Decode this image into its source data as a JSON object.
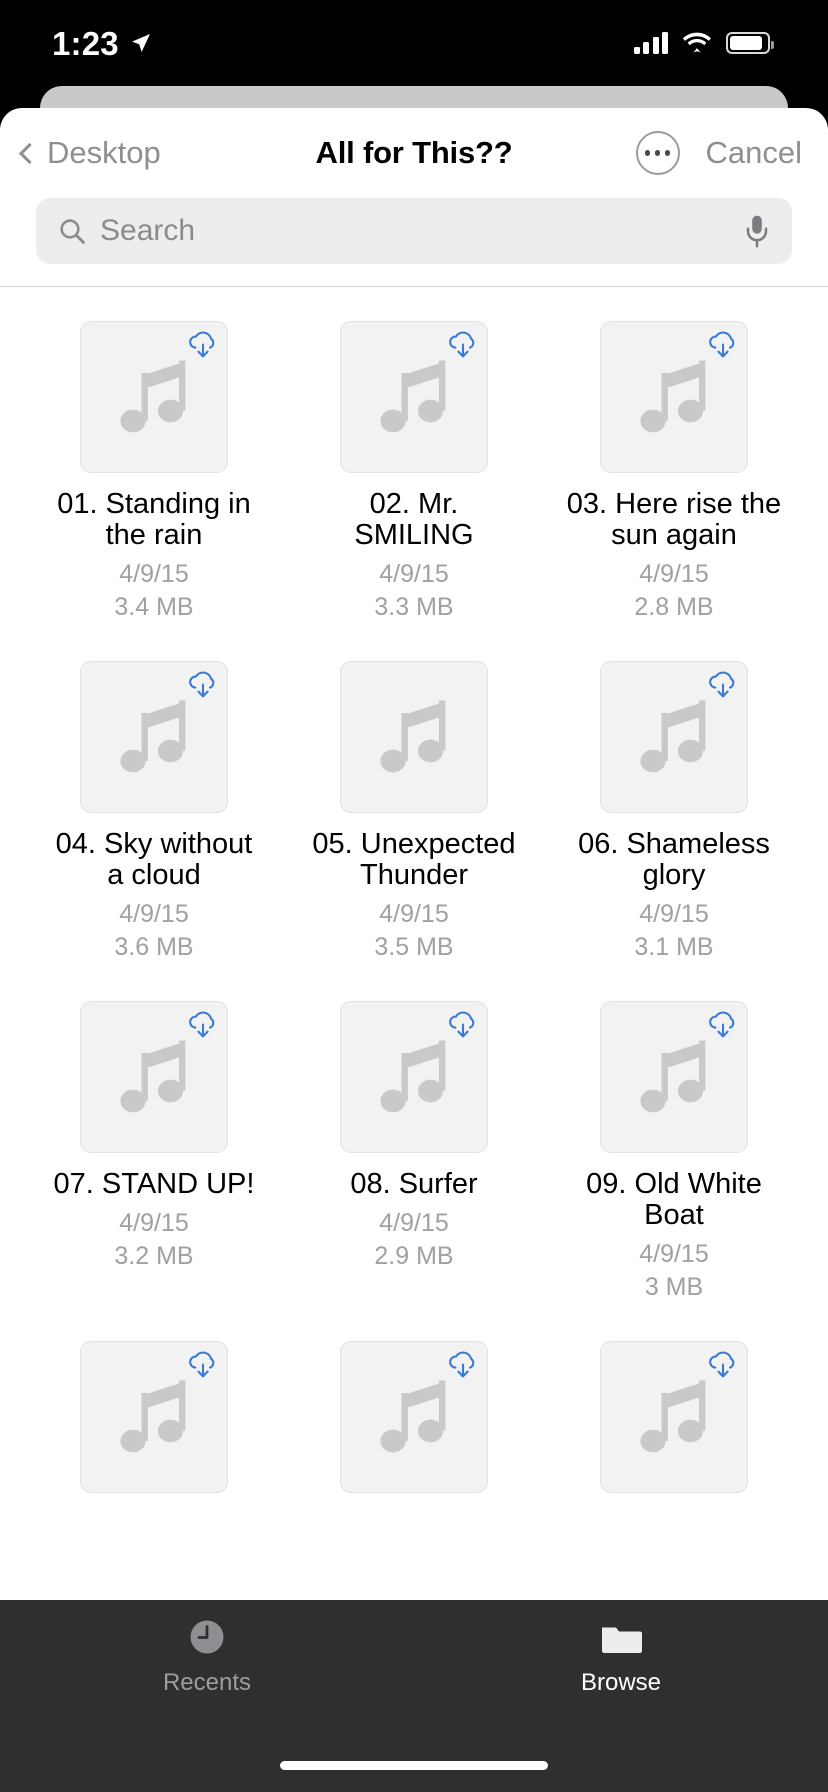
{
  "status_bar": {
    "time": "1:23",
    "location_icon": "location-arrow-icon",
    "cellular_icon": "cellular-signal-icon",
    "wifi_icon": "wifi-icon",
    "battery_icon": "battery-icon"
  },
  "nav": {
    "back_label": "Desktop",
    "title": "All for This??",
    "more_label": "more-options",
    "cancel_label": "Cancel"
  },
  "search": {
    "placeholder": "Search",
    "value": "",
    "icon": "search-icon",
    "mic_icon": "microphone-icon"
  },
  "colors": {
    "accent": "#007aff",
    "cloud_blue": "#3a7bd5",
    "tab_bar_bg": "#2f2f31",
    "thumb_bg": "#f2f2f3",
    "secondary_text": "#a0a0a5",
    "nav_gray": "#8e8e93"
  },
  "files": [
    {
      "name": "01. Standing in the rain",
      "date": "4/9/15",
      "size": "3.4 MB",
      "icon": "music-note-icon",
      "cloud": true
    },
    {
      "name": "02. Mr. SMILING",
      "date": "4/9/15",
      "size": "3.3 MB",
      "icon": "music-note-icon",
      "cloud": true
    },
    {
      "name": "03. Here rise the sun again",
      "date": "4/9/15",
      "size": "2.8 MB",
      "icon": "music-note-icon",
      "cloud": true
    },
    {
      "name": "04. Sky without a cloud",
      "date": "4/9/15",
      "size": "3.6 MB",
      "icon": "music-note-icon",
      "cloud": true
    },
    {
      "name": "05. Unexpected Thunder",
      "date": "4/9/15",
      "size": "3.5 MB",
      "icon": "music-note-icon",
      "cloud": false
    },
    {
      "name": "06. Shameless glory",
      "date": "4/9/15",
      "size": "3.1 MB",
      "icon": "music-note-icon",
      "cloud": true
    },
    {
      "name": "07. STAND UP!",
      "date": "4/9/15",
      "size": "3.2 MB",
      "icon": "music-note-icon",
      "cloud": true
    },
    {
      "name": "08. Surfer",
      "date": "4/9/15",
      "size": "2.9 MB",
      "icon": "music-note-icon",
      "cloud": true
    },
    {
      "name": "09. Old White Boat",
      "date": "4/9/15",
      "size": "3 MB",
      "icon": "music-note-icon",
      "cloud": true
    },
    {
      "name": "",
      "date": "",
      "size": "",
      "icon": "music-note-icon",
      "cloud": true
    },
    {
      "name": "",
      "date": "",
      "size": "",
      "icon": "music-note-icon",
      "cloud": true
    },
    {
      "name": "",
      "date": "",
      "size": "",
      "icon": "music-note-icon",
      "cloud": true
    }
  ],
  "tabs": [
    {
      "label": "Recents",
      "icon": "clock-icon",
      "active": false
    },
    {
      "label": "Browse",
      "icon": "folder-icon",
      "active": true
    }
  ]
}
